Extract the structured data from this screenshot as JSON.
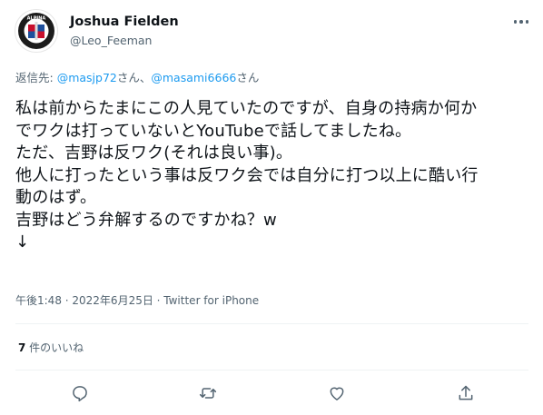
{
  "author": {
    "display_name": "Joshua Fielden",
    "handle": "@Leo_Feeman",
    "avatar_icon": "alpina-logo-icon",
    "avatar_logo_text": "ALPINA"
  },
  "reply_context": {
    "prefix": "返信先: ",
    "mentions": [
      {
        "handle": "@masjp72",
        "suffix": "さん、"
      },
      {
        "handle": "@masami6666",
        "suffix": "さん"
      }
    ]
  },
  "tweet": {
    "lines": [
      "私は前からたまにこの人見ていたのですが、自身の持病か何か",
      "でワクは打っていないとYouTubeで話してましたね。",
      "ただ、吉野は反ワク(それは良い事)。",
      "他人に打ったという事は反ワク会では自分に打つ以上に酷い行",
      "動のはず。",
      "吉野はどう弁解するのですかね？w",
      "↓"
    ],
    "timestamp": "午後1:48 · 2022年6月25日 · Twitter for iPhone"
  },
  "stats": {
    "like_count": "7",
    "like_label": " 件のいいね"
  },
  "actions": {
    "reply_icon": "reply-icon",
    "retweet_icon": "retweet-icon",
    "like_icon": "heart-icon",
    "share_icon": "share-icon",
    "more_icon": "more-options-icon"
  },
  "colors": {
    "link": "#1d9bf0",
    "secondary_text": "#536471",
    "divider": "#eff3f4",
    "text": "#0f1419"
  }
}
